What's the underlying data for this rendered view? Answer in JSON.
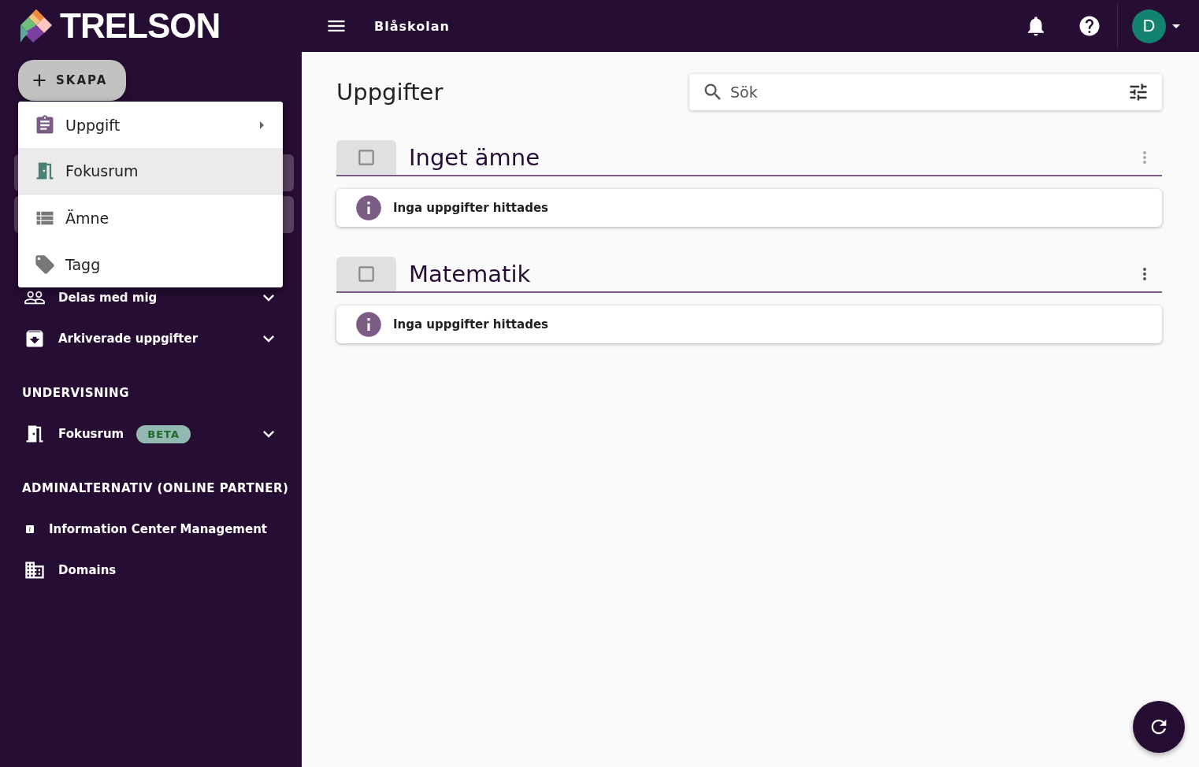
{
  "header": {
    "logo": "TRELSON",
    "school": "Blåskolan",
    "avatar": "D"
  },
  "create_button": "SKAPA",
  "create_menu": [
    {
      "label": "Uppgift",
      "kind": "assignment",
      "has_submenu": true,
      "highlighted": false,
      "divider_after": false
    },
    {
      "label": "Fokusrum",
      "kind": "room",
      "has_submenu": false,
      "highlighted": true,
      "divider_after": true
    },
    {
      "label": "Ämne",
      "kind": "list",
      "has_submenu": false,
      "highlighted": false,
      "divider_after": false
    },
    {
      "label": "Tagg",
      "kind": "tag",
      "has_submenu": false,
      "highlighted": false,
      "divider_after": false
    }
  ],
  "sidebar": {
    "groups": [
      {
        "items": [
          {
            "label": "Delas med mig",
            "kind": "shared",
            "expanded": false
          },
          {
            "label": "Arkiverade uppgifter",
            "kind": "archive",
            "expanded": false
          }
        ]
      },
      {
        "heading": "UNDERVISNING",
        "items": [
          {
            "label": "Fokusrum",
            "kind": "room",
            "badge": "BETA",
            "expanded": false
          }
        ]
      },
      {
        "heading": "ADMINALTERNATIV (ONLINE PARTNER)",
        "items": [
          {
            "label": "Information Center Management",
            "kind": "info"
          },
          {
            "label": "Domains",
            "kind": "domain"
          }
        ]
      }
    ]
  },
  "main": {
    "title": "Uppgifter",
    "search": {
      "placeholder": "Sök"
    },
    "groups": [
      {
        "title": "Inget ämne",
        "checked": false,
        "menu_disabled": true,
        "message": "Inga uppgifter hittades"
      },
      {
        "title": "Matematik",
        "checked": false,
        "menu_disabled": false,
        "message": "Inga uppgifter hittades"
      }
    ]
  }
}
